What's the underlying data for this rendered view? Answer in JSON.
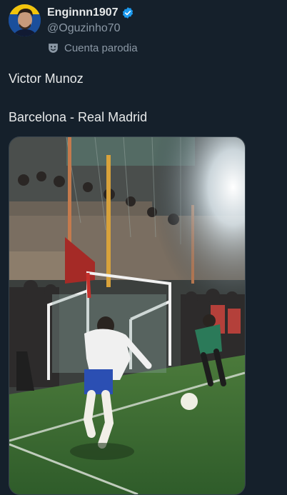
{
  "author": {
    "display_name": "Enginnn1907",
    "handle": "@Oguzinho70",
    "verified": true,
    "parody_label": "Cuenta parodia"
  },
  "tweet": {
    "lines": [
      "Victor Munoz",
      "Barcelona - Real Madrid"
    ]
  },
  "icons": {
    "verified": "verified-badge-icon",
    "parody": "parody-mask-icon"
  },
  "colors": {
    "background": "#15202b",
    "text_primary": "#e7e9ea",
    "text_secondary": "#8b98a5",
    "verified_blue": "#1d9bf0"
  }
}
